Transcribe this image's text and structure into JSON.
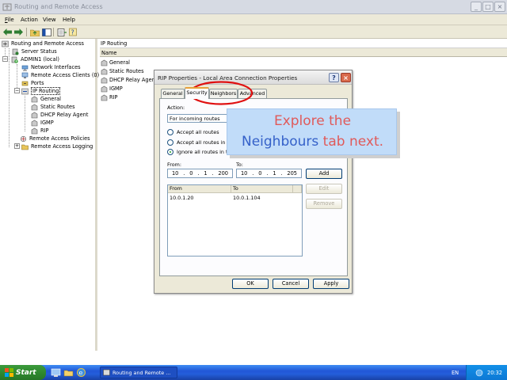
{
  "window": {
    "title": "Routing and Remote Access",
    "controls": {
      "minimize": "_",
      "maximize": "□",
      "close": "×"
    }
  },
  "menu": {
    "file": "File",
    "action": "Action",
    "view": "View",
    "help": "Help"
  },
  "toolbar": {
    "icons": [
      "back-arrow-icon",
      "forward-arrow-icon",
      "up-folder-icon",
      "show-hide-tree-icon",
      "export-list-icon",
      "help-icon"
    ]
  },
  "tree": {
    "root": "Routing and Remote Access",
    "server_status": "Server Status",
    "server": "ADMIN1 (local)",
    "network_interfaces": "Network Interfaces",
    "remote_access_clients": "Remote Access Clients (0)",
    "ports": "Ports",
    "ip_routing": "IP Routing",
    "general": "General",
    "static_routes": "Static Routes",
    "dhcp_relay_agent": "DHCP Relay Agent",
    "igmp": "IGMP",
    "rip": "RIP",
    "remote_access_policies": "Remote Access Policies",
    "remote_access_logging": "Remote Access Logging"
  },
  "right_pane": {
    "title": "IP Routing",
    "column_name": "Name",
    "items": [
      "General",
      "Static Routes",
      "DHCP Relay Agent",
      "IGMP",
      "RIP"
    ]
  },
  "dialog": {
    "title": "RIP Properties - Local Area Connection Properties",
    "help_button": "?",
    "close_button": "×",
    "tabs": {
      "general": "General",
      "security": "Security",
      "neighbors": "Neighbors",
      "advanced": "Advanced"
    },
    "action_label": "Action:",
    "action_value": "For incoming routes",
    "radio_accept_all": "Accept all routes",
    "radio_accept_listed": "Accept all routes in the",
    "radio_ignore_listed": "Ignore all routes in the r",
    "from_label": "From:",
    "to_label": "To:",
    "from_ip": [
      "10",
      "0",
      "1",
      "200"
    ],
    "to_ip": [
      "10",
      "0",
      "1",
      "205"
    ],
    "list_header_from": "From",
    "list_header_to": "To",
    "list_rows": [
      {
        "from": "10.0.1.20",
        "to": "10.0.1.104"
      }
    ],
    "add_button": "Add",
    "edit_button": "Edit",
    "remove_button": "Remove",
    "ok_button": "OK",
    "cancel_button": "Cancel",
    "apply_button": "Apply"
  },
  "callout": {
    "line1": "Explore the",
    "word_neighbours": "Neighbours",
    "word_tab_next": "tab next."
  },
  "taskbar": {
    "start": "Start",
    "task_item": "Routing and Remote ...",
    "language": "EN",
    "clock": "20:32"
  },
  "colors": {
    "callout_bg": "#c1dcf9",
    "callout_red": "#e05a5a",
    "callout_blue": "#3561c9",
    "highlight_circle": "#e01010",
    "taskbar_blue": "#245edb",
    "start_green": "#2f8a2f"
  }
}
